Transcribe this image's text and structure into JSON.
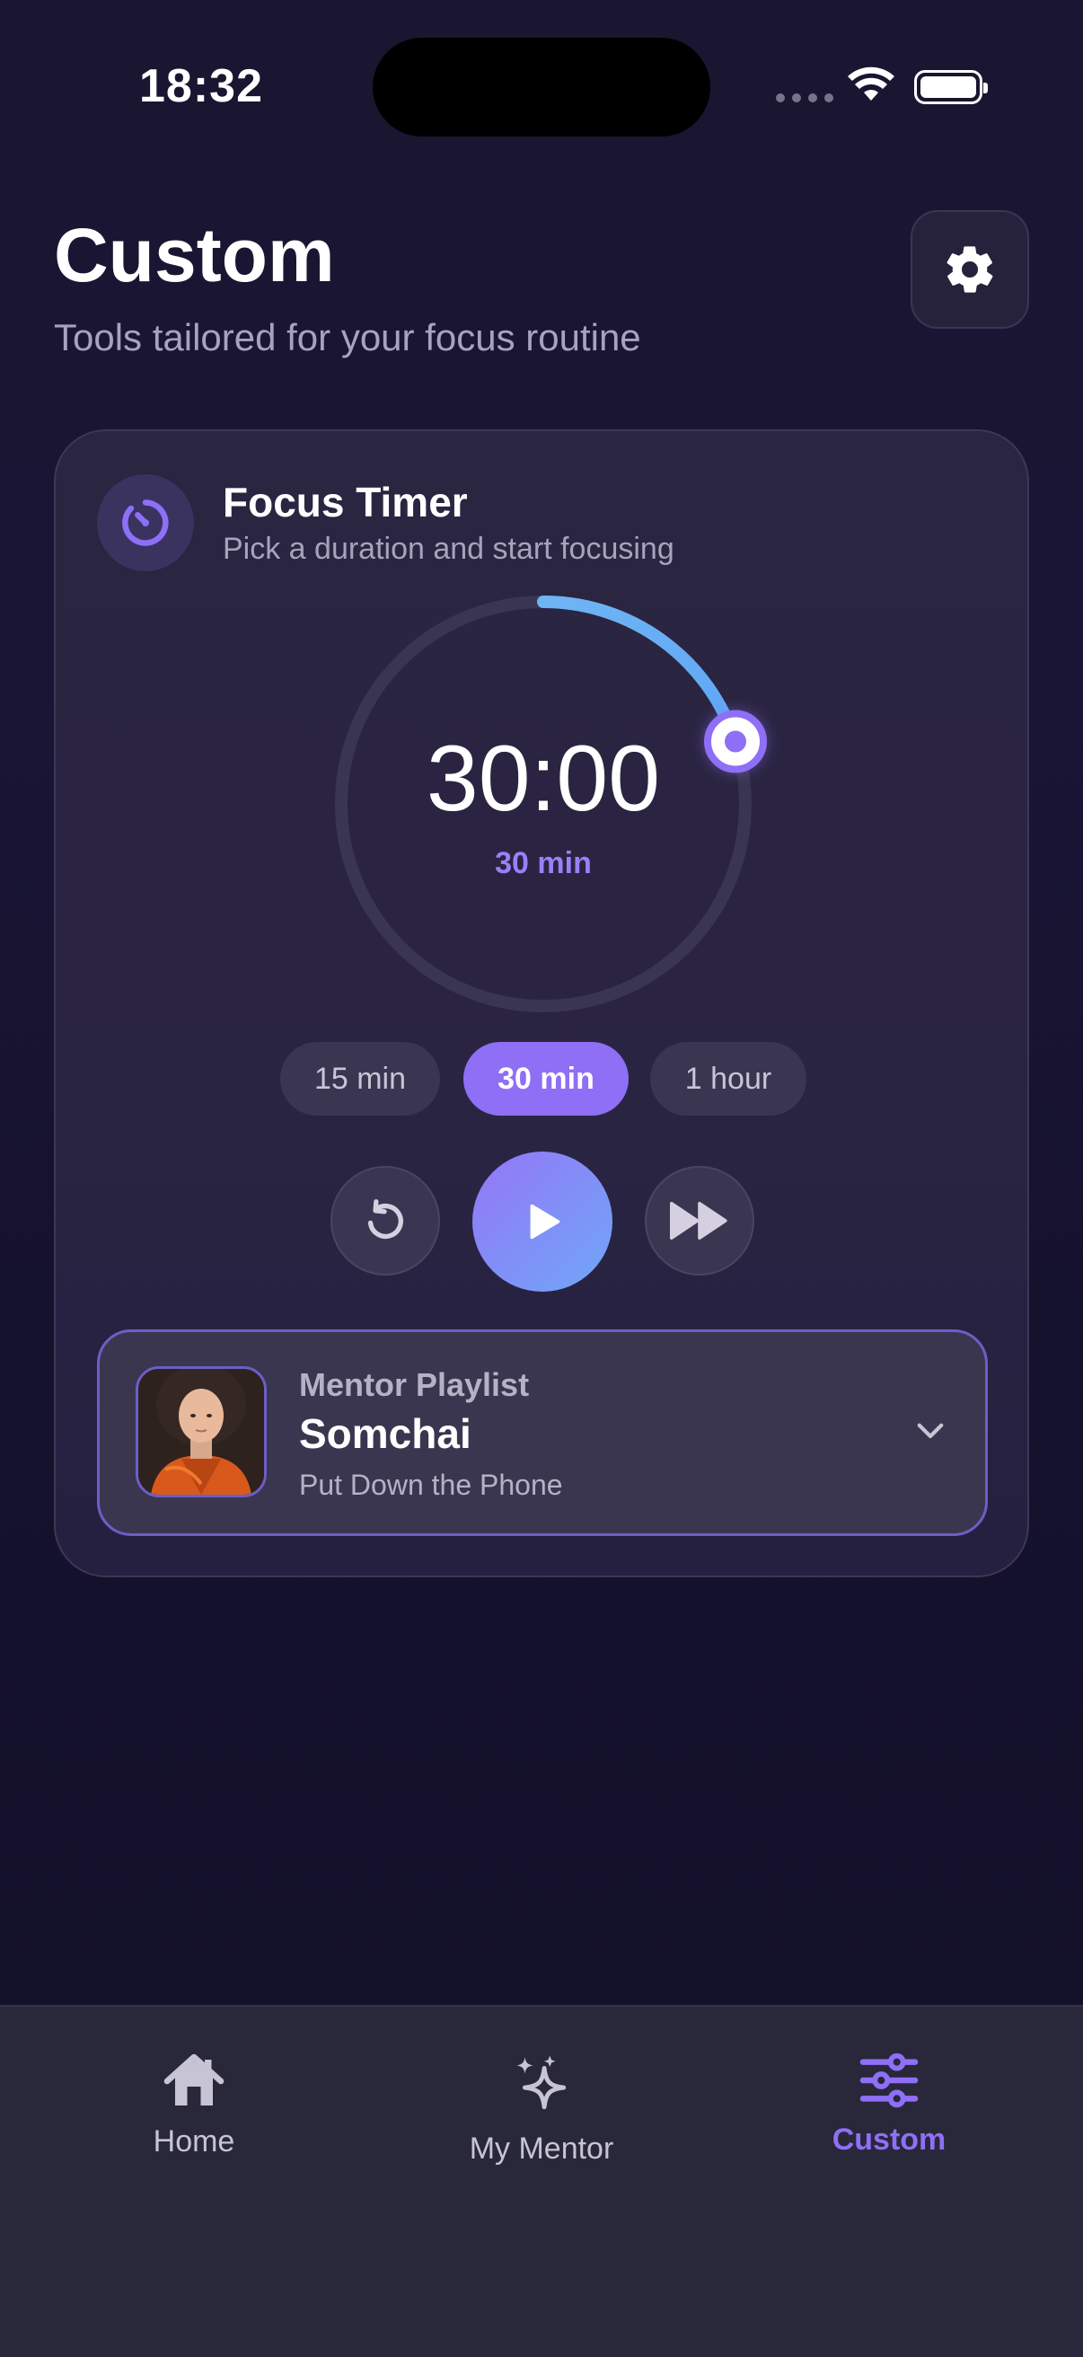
{
  "status_bar": {
    "time": "18:32"
  },
  "header": {
    "title": "Custom",
    "subtitle": "Tools tailored for your focus routine"
  },
  "focus_timer": {
    "title": "Focus Timer",
    "subtitle": "Pick a duration and start focusing",
    "time_display": "30:00",
    "duration_label": "30 min",
    "dial_progress": 0.2,
    "presets": [
      {
        "label": "15 min",
        "selected": false
      },
      {
        "label": "30 min",
        "selected": true
      },
      {
        "label": "1 hour",
        "selected": false
      }
    ]
  },
  "playlist": {
    "label": "Mentor Playlist",
    "mentor": "Somchai",
    "track": "Put Down the Phone"
  },
  "tabs": [
    {
      "label": "Home",
      "icon": "home-icon",
      "active": false
    },
    {
      "label": "My Mentor",
      "icon": "sparkle-icon",
      "active": false
    },
    {
      "label": "Custom",
      "icon": "sliders-icon",
      "active": true
    }
  ],
  "colors": {
    "accent": "#8e6ff6",
    "accent_blue": "#6fb4f4",
    "background": "#1a1530"
  }
}
